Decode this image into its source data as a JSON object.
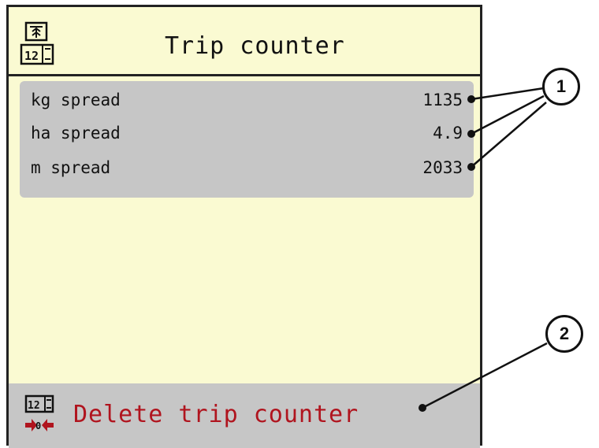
{
  "header": {
    "title": "Trip counter",
    "icon": "trip-counter-icon"
  },
  "counters": [
    {
      "label": "kg spread",
      "value": "1135"
    },
    {
      "label": "ha spread",
      "value": "4.9"
    },
    {
      "label": "m spread",
      "value": "2033"
    }
  ],
  "action": {
    "label": "Delete trip counter",
    "icon": "delete-counter-icon"
  },
  "callouts": {
    "one": "1",
    "two": "2"
  },
  "colors": {
    "background": "#fafad2",
    "panel": "#c6c6c6",
    "action_text": "#b0141e"
  }
}
